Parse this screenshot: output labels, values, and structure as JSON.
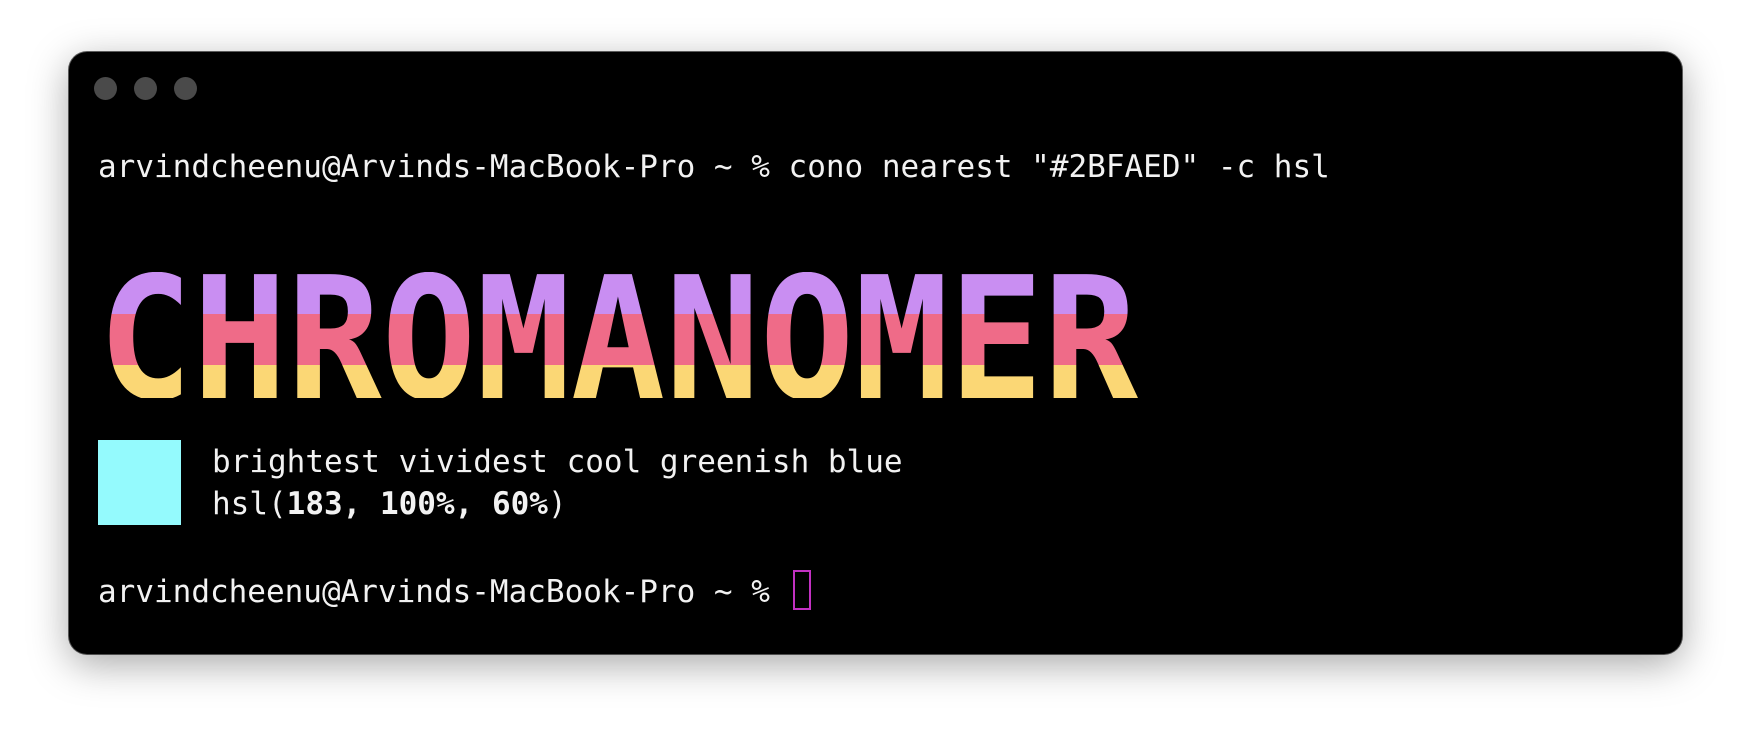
{
  "window": {
    "controls": [
      "close-dot",
      "minimize-dot",
      "zoom-dot"
    ]
  },
  "terminal": {
    "command_line": "arvindcheenu@Arvinds-MacBook-Pro ~ % cono nearest \"#2BFAED\" -c hsl",
    "banner_text": "CHROMANOMER",
    "banner_colors": [
      "#c98ef2",
      "#ef6b88",
      "#fbd775"
    ],
    "swatch_color": "#94fafd",
    "color_name": "brightest vividest cool greenish blue",
    "hsl_prefix": "hsl(",
    "hsl_values": "183, 100%, 60%",
    "hsl_suffix": ")",
    "prompt": "arvindcheenu@Arvinds-MacBook-Pro ~ % ",
    "cursor_color": "#c231c2"
  }
}
